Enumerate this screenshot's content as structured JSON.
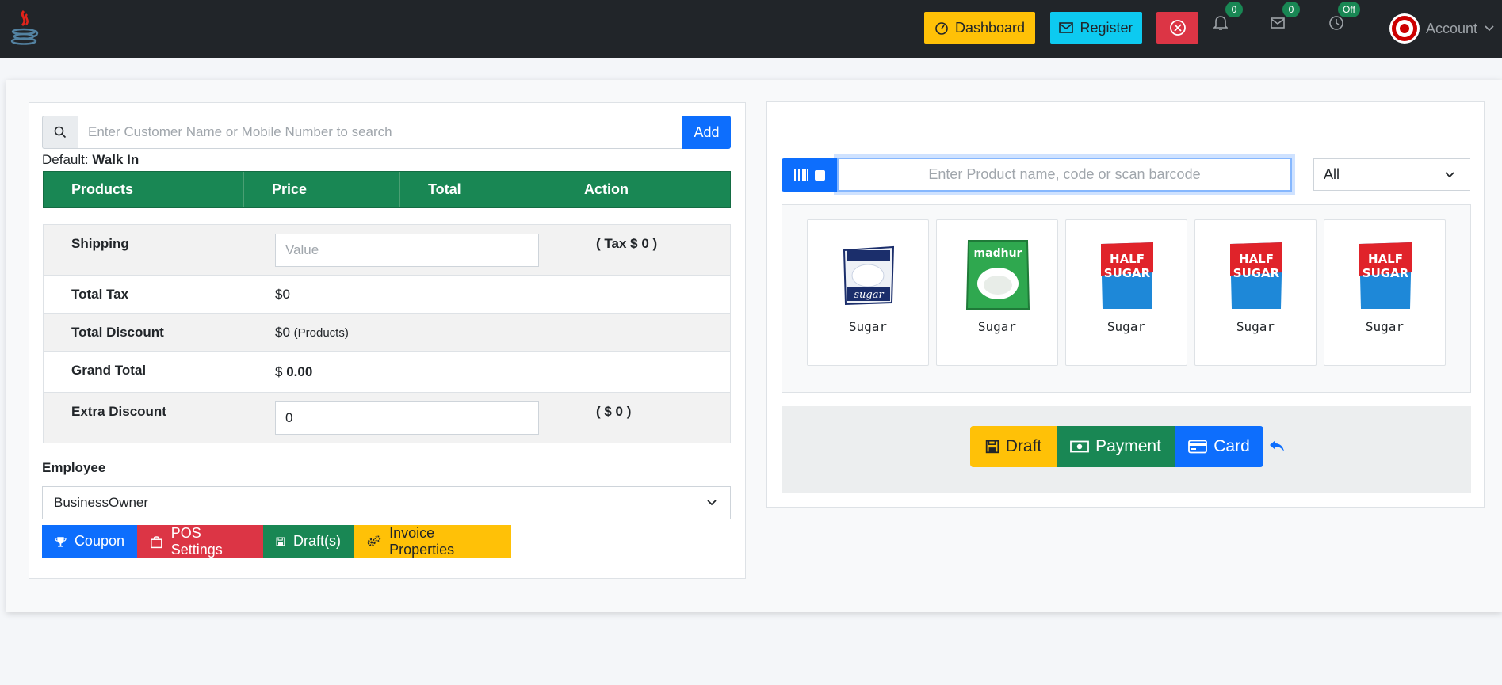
{
  "navbar": {
    "dashboard_label": "Dashboard",
    "register_label": "Register",
    "notifications_count": "0",
    "messages_count": "0",
    "clock_status": "Off",
    "account_label": "Account"
  },
  "customer": {
    "search_placeholder": "Enter Customer Name or Mobile Number to search",
    "add_label": "Add",
    "default_prefix": "Default:",
    "default_value": "Walk In"
  },
  "products_table": {
    "headers": [
      "Products",
      "Price",
      "Total",
      "Action"
    ]
  },
  "summary": {
    "shipping_label": "Shipping",
    "shipping_placeholder": "Value",
    "shipping_tax": "( Tax $ 0 )",
    "total_tax_label": "Total Tax",
    "total_tax_value": "$0",
    "total_discount_label": "Total Discount",
    "total_discount_value": "$0",
    "total_discount_note": "(Products)",
    "grand_total_label": "Grand Total",
    "grand_total_currency": "$",
    "grand_total_value": "0.00",
    "extra_discount_label": "Extra Discount",
    "extra_discount_value": "0",
    "extra_discount_note": "( $ 0 )"
  },
  "employee": {
    "label": "Employee",
    "selected": "BusinessOwner"
  },
  "bottom_buttons": {
    "coupon": "Coupon",
    "pos_settings": "POS Settings",
    "drafts": "Draft(s)",
    "invoice_properties": "Invoice Properties"
  },
  "product_search": {
    "placeholder": "Enter Product name, code or scan barcode",
    "category_selected": "All"
  },
  "products": [
    {
      "name": "Sugar",
      "image": "sugar-bag-white"
    },
    {
      "name": "Sugar",
      "image": "sugar-bag-green"
    },
    {
      "name": "Sugar",
      "image": "sugar-bag-red"
    },
    {
      "name": "Sugar",
      "image": "sugar-bag-red"
    },
    {
      "name": "Sugar",
      "image": "sugar-bag-red"
    }
  ],
  "actions": {
    "draft": "Draft",
    "payment": "Payment",
    "card": "Card"
  },
  "colors": {
    "navbar": "#212529",
    "primary": "#0d6efd",
    "success": "#198754",
    "danger": "#dc3545",
    "warning": "#ffc107",
    "info": "#0dcaf0"
  }
}
